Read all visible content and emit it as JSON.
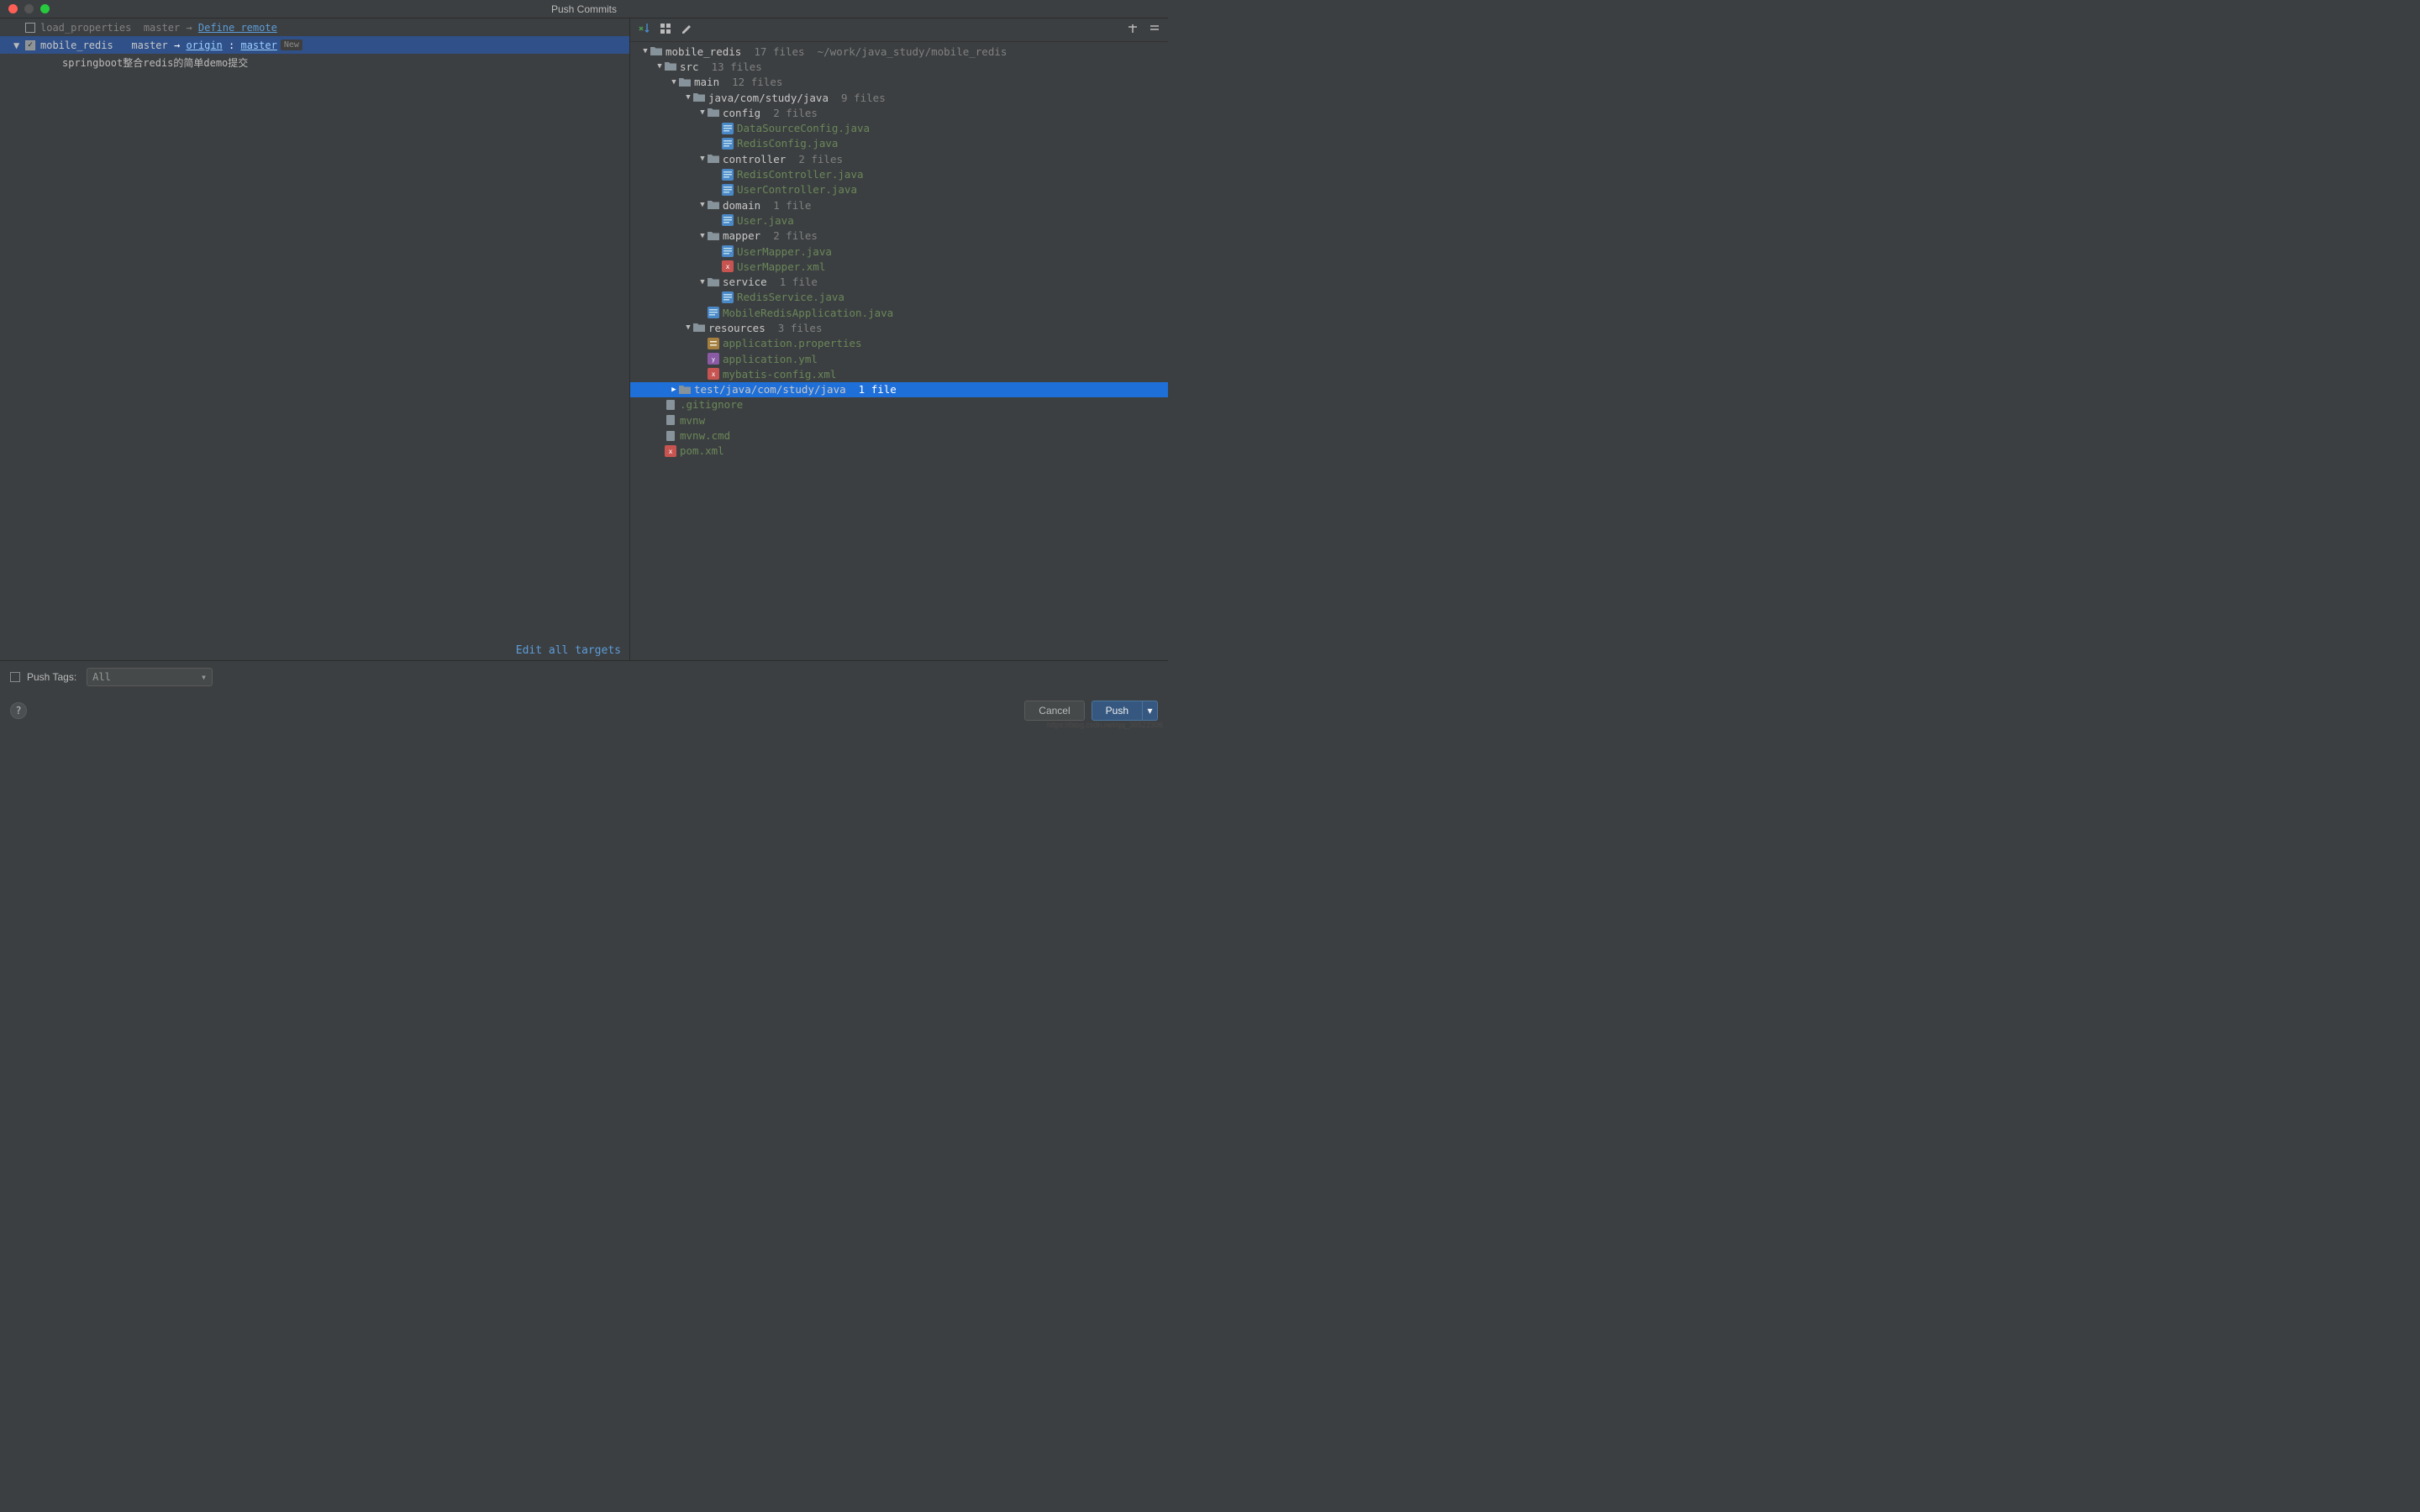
{
  "title": "Push Commits",
  "repos": [
    {
      "checked": false,
      "name": "load_properties",
      "local": "master",
      "remoteAction": "Define remote"
    },
    {
      "checked": true,
      "name": "mobile_redis",
      "local": "master",
      "remoteName": "origin",
      "remoteBranch": "master",
      "isNew": true
    }
  ],
  "commit_message": "springboot整合redis的简单demo提交",
  "edit_targets": "Edit all targets",
  "root": {
    "name": "mobile_redis",
    "count": "17 files",
    "path": "~/work/java_study/mobile_redis"
  },
  "tree": [
    {
      "depth": 0,
      "arrow": "down",
      "type": "module",
      "name": "mobile_redis",
      "count": "17 files",
      "extra": "~/work/java_study/mobile_redis"
    },
    {
      "depth": 1,
      "arrow": "down",
      "type": "folder",
      "name": "src",
      "count": "13 files"
    },
    {
      "depth": 2,
      "arrow": "down",
      "type": "folder",
      "name": "main",
      "count": "12 files"
    },
    {
      "depth": 3,
      "arrow": "down",
      "type": "folder",
      "name": "java/com/study/java",
      "count": "9 files"
    },
    {
      "depth": 4,
      "arrow": "down",
      "type": "folder",
      "name": "config",
      "count": "2 files"
    },
    {
      "depth": 5,
      "arrow": "",
      "type": "java",
      "name": "DataSourceConfig.java"
    },
    {
      "depth": 5,
      "arrow": "",
      "type": "java",
      "name": "RedisConfig.java"
    },
    {
      "depth": 4,
      "arrow": "down",
      "type": "folder",
      "name": "controller",
      "count": "2 files"
    },
    {
      "depth": 5,
      "arrow": "",
      "type": "java",
      "name": "RedisController.java"
    },
    {
      "depth": 5,
      "arrow": "",
      "type": "java",
      "name": "UserController.java"
    },
    {
      "depth": 4,
      "arrow": "down",
      "type": "folder",
      "name": "domain",
      "count": "1 file"
    },
    {
      "depth": 5,
      "arrow": "",
      "type": "java",
      "name": "User.java"
    },
    {
      "depth": 4,
      "arrow": "down",
      "type": "folder",
      "name": "mapper",
      "count": "2 files"
    },
    {
      "depth": 5,
      "arrow": "",
      "type": "java",
      "name": "UserMapper.java"
    },
    {
      "depth": 5,
      "arrow": "",
      "type": "xml",
      "name": "UserMapper.xml"
    },
    {
      "depth": 4,
      "arrow": "down",
      "type": "folder",
      "name": "service",
      "count": "1 file"
    },
    {
      "depth": 5,
      "arrow": "",
      "type": "java",
      "name": "RedisService.java"
    },
    {
      "depth": 4,
      "arrow": "",
      "type": "java",
      "name": "MobileRedisApplication.java"
    },
    {
      "depth": 3,
      "arrow": "down",
      "type": "folder",
      "name": "resources",
      "count": "3 files"
    },
    {
      "depth": 4,
      "arrow": "",
      "type": "props",
      "name": "application.properties"
    },
    {
      "depth": 4,
      "arrow": "",
      "type": "yml",
      "name": "application.yml"
    },
    {
      "depth": 4,
      "arrow": "",
      "type": "xml",
      "name": "mybatis-config.xml"
    },
    {
      "depth": 2,
      "arrow": "right",
      "type": "folder",
      "name": "test/java/com/study/java",
      "count": "1 file",
      "selected": true
    },
    {
      "depth": 1,
      "arrow": "",
      "type": "text",
      "name": ".gitignore"
    },
    {
      "depth": 1,
      "arrow": "",
      "type": "text",
      "name": "mvnw"
    },
    {
      "depth": 1,
      "arrow": "",
      "type": "text",
      "name": "mvnw.cmd"
    },
    {
      "depth": 1,
      "arrow": "",
      "type": "xml",
      "name": "pom.xml"
    }
  ],
  "push_tags_label": "Push Tags:",
  "combo_value": "All",
  "cancel_button": "Cancel",
  "push_button": "Push",
  "watermark": "https://blog.csdn.net/qq_36522306"
}
